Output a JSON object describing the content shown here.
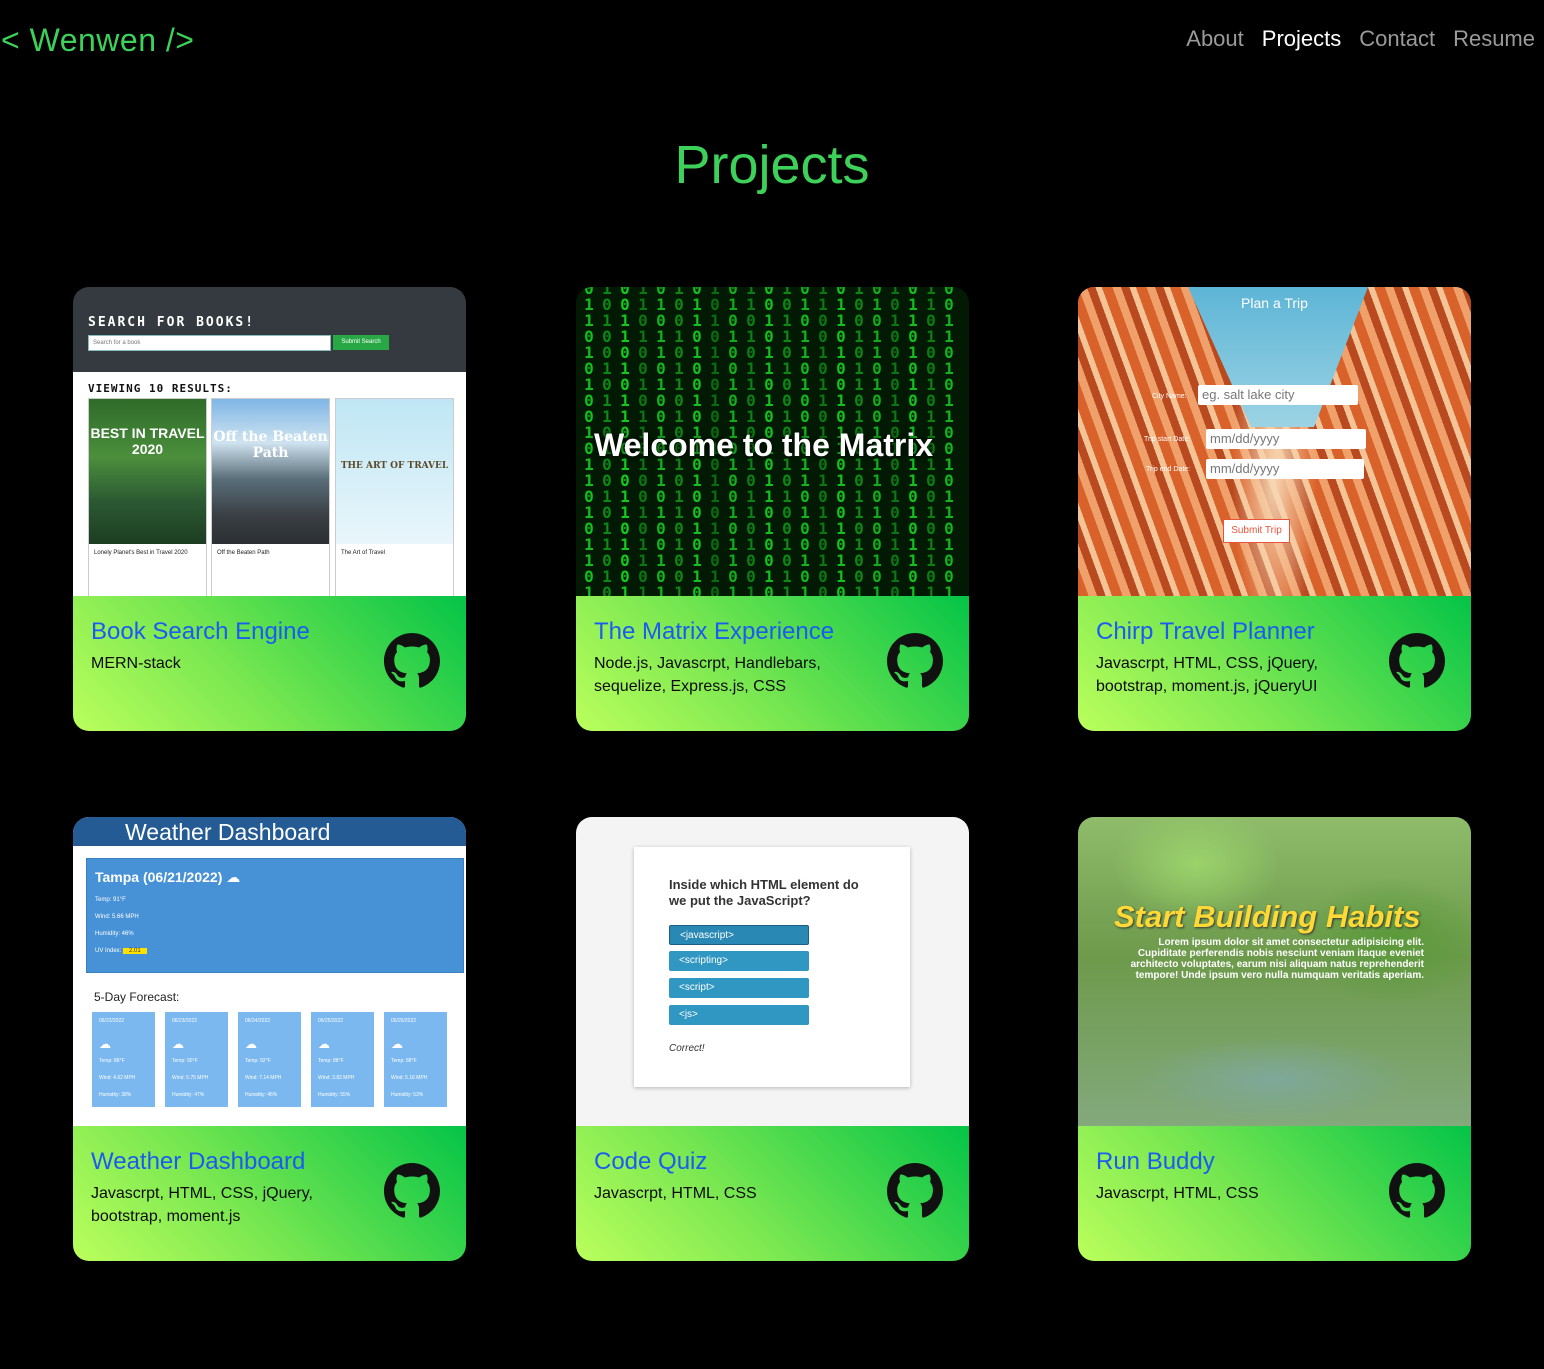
{
  "header": {
    "logo": "< Wenwen />",
    "nav": [
      "About",
      "Projects",
      "Contact",
      "Resume"
    ],
    "active_nav": "Projects"
  },
  "page_title": "Projects",
  "colors": {
    "accent": "#3ed15a",
    "title_blue": "#1a5cf2",
    "background": "#000000"
  },
  "projects": [
    {
      "title": "Book Search Engine",
      "tech": "MERN-stack",
      "icon": "github-icon",
      "screenshot": {
        "heading": "SEARCH FOR BOOKS!",
        "search_placeholder": "Search for a book",
        "submit": "Submit Search",
        "results": "VIEWING 10 RESULTS:",
        "books": [
          {
            "cover": "BEST IN TRAVEL 2020",
            "caption": "Lonely Planet's Best in Travel 2020"
          },
          {
            "cover": "Off the Beaten Path",
            "caption": "Off the Beaten Path"
          },
          {
            "cover": "THE ART OF TRAVEL",
            "caption": "The Art of Travel"
          }
        ]
      }
    },
    {
      "title": "The Matrix Experience",
      "tech": "Node.js, Javascrpt, Handlebars, sequelize, Express.js, CSS",
      "icon": "github-icon",
      "screenshot": {
        "heading": "Welcome to the Matrix"
      }
    },
    {
      "title": "Chirp Travel Planner",
      "tech": "Javascrpt, HTML, CSS, jQuery, bootstrap, moment.js, jQueryUI",
      "icon": "github-icon",
      "screenshot": {
        "heading": "Plan a Trip",
        "city_label": "City Name:",
        "city_placeholder": "eg. salt lake city",
        "start_label": "Trip start Date:",
        "start_placeholder": "mm/dd/yyyy",
        "end_label": "Trip end Date:",
        "end_placeholder": "mm/dd/yyyy",
        "submit": "Submit Trip"
      }
    },
    {
      "title": "Weather Dashboard",
      "tech": "Javascrpt, HTML, CSS, jQuery, bootstrap, moment.js",
      "icon": "github-icon",
      "screenshot": {
        "heading": "Weather Dashboard",
        "city": "Tampa (06/21/2022) ☁",
        "temp": "Temp: 91°F",
        "wind": "Wind: 5.66 MPH",
        "humidity": "Humidity: 46%",
        "uv_label": "UV Index:",
        "uv": "2.01",
        "forecast_label": "5-Day Forecast:",
        "days": [
          {
            "date": "06/22/2022",
            "temp": "Temp: 88°F",
            "wind": "Wind: 4.62 MPH",
            "humidity": "Humidity: 38%"
          },
          {
            "date": "06/23/2022",
            "temp": "Temp: 90°F",
            "wind": "Wind: 5.75 MPH",
            "humidity": "Humidity: 47%"
          },
          {
            "date": "06/24/2022",
            "temp": "Temp: 92°F",
            "wind": "Wind: 7.14 MPH",
            "humidity": "Humidity: 46%"
          },
          {
            "date": "06/25/2022",
            "temp": "Temp: 88°F",
            "wind": "Wind: 3.82 MPH",
            "humidity": "Humidity: 55%"
          },
          {
            "date": "06/26/2022",
            "temp": "Temp: 88°F",
            "wind": "Wind: 5.16 MPH",
            "humidity": "Humidity: 53%"
          }
        ]
      }
    },
    {
      "title": "Code Quiz",
      "tech": "Javascrpt, HTML, CSS",
      "icon": "github-icon",
      "screenshot": {
        "question": "Inside which HTML element do we put the JavaScript?",
        "options": [
          "<javascript>",
          "<scripting>",
          "<script>",
          "<js>"
        ],
        "result": "Correct!"
      }
    },
    {
      "title": "Run Buddy",
      "tech": "Javascrpt, HTML, CSS",
      "icon": "github-icon",
      "screenshot": {
        "heading": "Start Building Habits",
        "body": "Lorem ipsum dolor sit amet consectetur adipisicing elit. Cupiditate perferendis nobis nesciunt veniam itaque eveniet architecto voluptates, earum nisi aliquam natus reprehenderit tempore! Unde ipsum vero nulla numquam veritatis aperiam."
      }
    }
  ]
}
